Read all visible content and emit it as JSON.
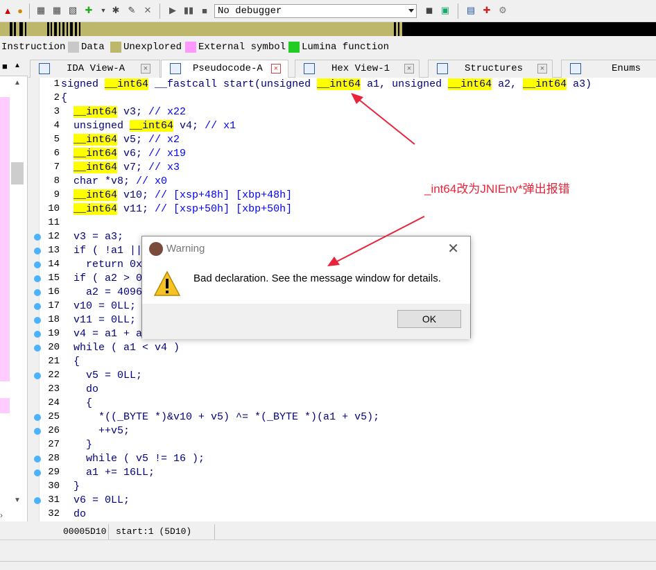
{
  "toolbar": {
    "debugger_value": "No debugger",
    "icons": [
      "new-icon",
      "lock-icon",
      "add-icon",
      "add-icon",
      "add-icon",
      "script-icon",
      "dropdown-icon",
      "run-icon",
      "note-icon",
      "close-icon",
      "play-icon",
      "pause-icon",
      "stop-icon",
      "debugger-dropdown-icon",
      "breakpoint-icon",
      "attach-icon",
      "list-icon",
      "plus-icon",
      "tools-icon"
    ]
  },
  "legend": [
    {
      "label": "Instruction",
      "color": "#ffffff"
    },
    {
      "label": "Data",
      "color": "#c8c8c8"
    },
    {
      "label": "Unexplored",
      "color": "#bdb76b"
    },
    {
      "label": "External symbol",
      "color": "#ff99ff"
    },
    {
      "label": "Lumina function",
      "color": "#22cc22"
    }
  ],
  "left_panel": {
    "header_label": "▪"
  },
  "tabs": [
    {
      "label": "IDA View-A",
      "active": false
    },
    {
      "label": "Pseudocode-A",
      "active": true
    },
    {
      "label": "Hex View-1",
      "active": false
    },
    {
      "label": "Structures",
      "active": false
    },
    {
      "label": "Enums",
      "active": false
    }
  ],
  "code": {
    "line_numbers": [
      "1",
      "2",
      "3",
      "4",
      "5",
      "6",
      "7",
      "8",
      "9",
      "10",
      "11",
      "12",
      "13",
      "14",
      "15",
      "16",
      "17",
      "18",
      "19",
      "20",
      "21",
      "22",
      "23",
      "24",
      "25",
      "26",
      "27",
      "28",
      "29",
      "30",
      "31",
      "32"
    ],
    "breakpoint_lines": [
      12,
      13,
      14,
      15,
      16,
      17,
      18,
      19,
      20,
      22,
      25,
      26,
      28,
      29,
      31
    ],
    "lines": [
      [
        [
          "t",
          "signed "
        ],
        [
          "h",
          "__int64"
        ],
        [
          "t",
          " __fastcall start(unsigned "
        ],
        [
          "h",
          "__int64"
        ],
        [
          "t",
          " a1, unsigned "
        ],
        [
          "h",
          "__int64"
        ],
        [
          "t",
          " a2, "
        ],
        [
          "h",
          "__int64"
        ],
        [
          "t",
          " a3)"
        ]
      ],
      [
        [
          "t",
          "{"
        ]
      ],
      [
        [
          "t",
          "  "
        ],
        [
          "h",
          "__int64"
        ],
        [
          "t",
          " v3; "
        ],
        [
          "c",
          "// x22"
        ]
      ],
      [
        [
          "t",
          "  unsigned "
        ],
        [
          "h",
          "__int64"
        ],
        [
          "t",
          " v4; "
        ],
        [
          "c",
          "// x1"
        ]
      ],
      [
        [
          "t",
          "  "
        ],
        [
          "h",
          "__int64"
        ],
        [
          "t",
          " v5; "
        ],
        [
          "c",
          "// x2"
        ]
      ],
      [
        [
          "t",
          "  "
        ],
        [
          "h",
          "__int64"
        ],
        [
          "t",
          " v6; "
        ],
        [
          "c",
          "// x19"
        ]
      ],
      [
        [
          "t",
          "  "
        ],
        [
          "h",
          "__int64"
        ],
        [
          "t",
          " v7; "
        ],
        [
          "c",
          "// x3"
        ]
      ],
      [
        [
          "t",
          "  char *v8; "
        ],
        [
          "c",
          "// x0"
        ]
      ],
      [
        [
          "t",
          "  "
        ],
        [
          "h",
          "__int64"
        ],
        [
          "t",
          " v10; "
        ],
        [
          "c",
          "// [xsp+48h] [xbp+48h]"
        ]
      ],
      [
        [
          "t",
          "  "
        ],
        [
          "h",
          "__int64"
        ],
        [
          "t",
          " v11; "
        ],
        [
          "c",
          "// [xsp+50h] [xbp+50h]"
        ]
      ],
      [
        [
          "t",
          ""
        ]
      ],
      [
        [
          "t",
          "  v3 = a3;"
        ]
      ],
      [
        [
          "t",
          "  if ( !a1 || "
        ]
      ],
      [
        [
          "t",
          "    return 0x"
        ]
      ],
      [
        [
          "t",
          "  if ( a2 > 0"
        ]
      ],
      [
        [
          "t",
          "    a2 = 4096"
        ]
      ],
      [
        [
          "t",
          "  v10 = 0LL;"
        ]
      ],
      [
        [
          "t",
          "  v11 = 0LL;"
        ]
      ],
      [
        [
          "t",
          "  v4 = a1 + a"
        ]
      ],
      [
        [
          "t",
          "  while ( a1 < v4 )"
        ]
      ],
      [
        [
          "t",
          "  {"
        ]
      ],
      [
        [
          "t",
          "    v5 = 0LL;"
        ]
      ],
      [
        [
          "t",
          "    do"
        ]
      ],
      [
        [
          "t",
          "    {"
        ]
      ],
      [
        [
          "t",
          "      *((_BYTE *)&v10 + v5) ^= *(_BYTE *)(a1 + v5);"
        ]
      ],
      [
        [
          "t",
          "      ++v5;"
        ]
      ],
      [
        [
          "t",
          "    }"
        ]
      ],
      [
        [
          "t",
          "    while ( v5 != 16 );"
        ]
      ],
      [
        [
          "t",
          "    a1 += 16LL;"
        ]
      ],
      [
        [
          "t",
          "  }"
        ]
      ],
      [
        [
          "t",
          "  v6 = 0LL;"
        ]
      ],
      [
        [
          "t",
          "  do"
        ]
      ]
    ]
  },
  "status": {
    "address": "00005D10",
    "location": "start:1 (5D10)"
  },
  "dialog": {
    "title": "Warning",
    "message": "Bad declaration. See the message window for details.",
    "ok_label": "OK"
  },
  "annotation": {
    "text": "_int64改为JNIEnv*弹出报错",
    "color": "#e8233a"
  }
}
